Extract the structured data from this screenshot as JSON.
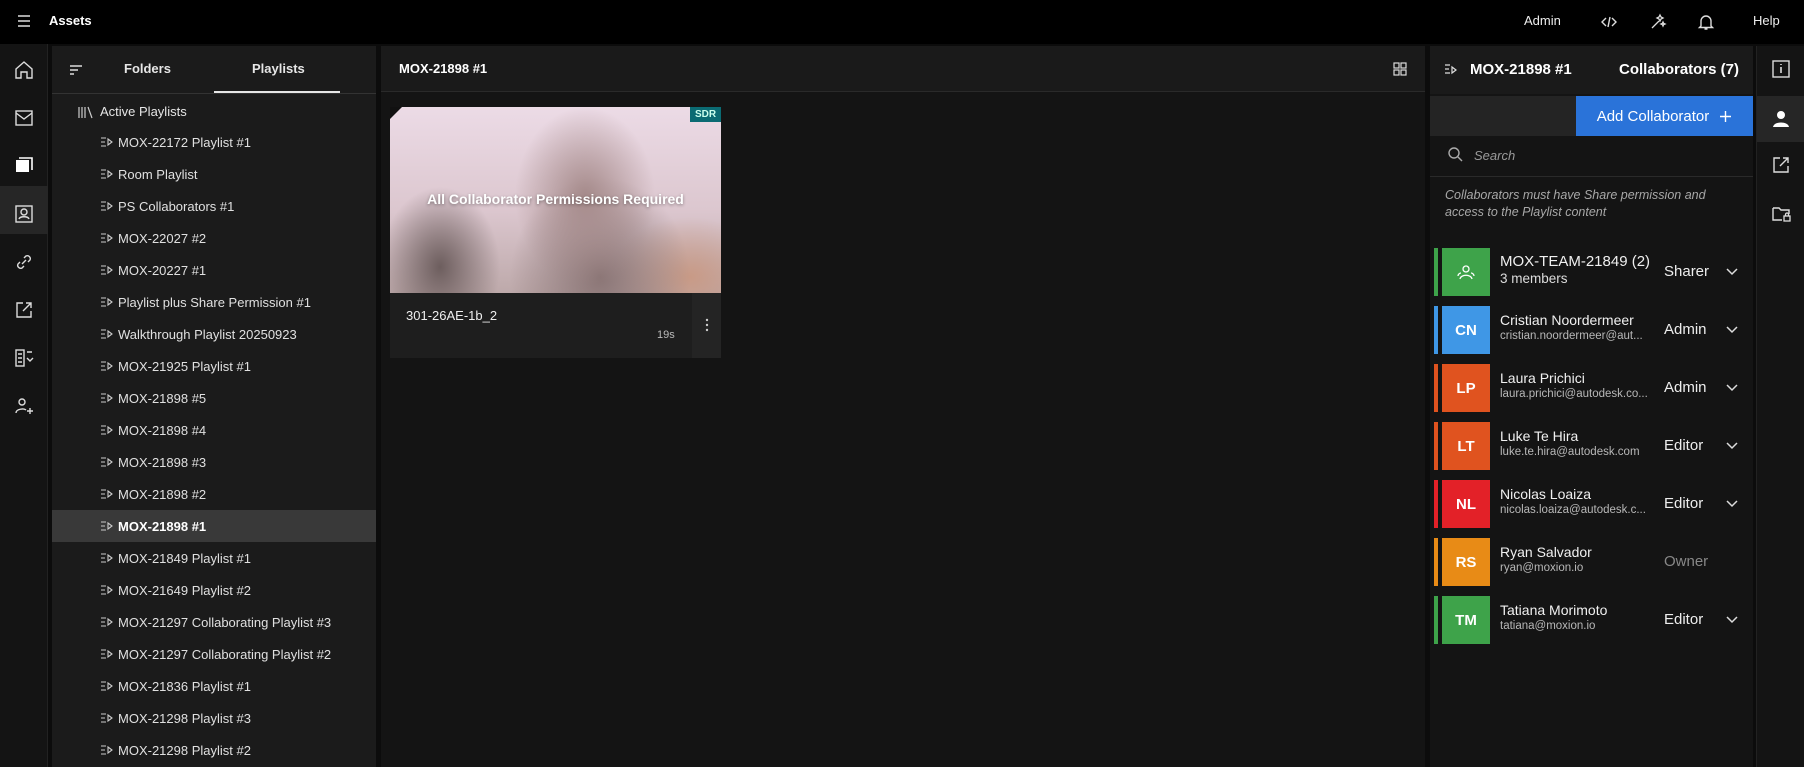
{
  "topbar": {
    "title": "Assets",
    "admin": "Admin",
    "help": "Help"
  },
  "sidebar": {
    "tabs": [
      {
        "label": "Folders"
      },
      {
        "label": "Playlists"
      }
    ],
    "section": "Active Playlists",
    "items": [
      "MOX-22172 Playlist #1",
      "Room Playlist",
      "PS Collaborators #1",
      "MOX-22027 #2",
      "MOX-20227 #1",
      "Playlist plus Share Permission #1",
      "Walkthrough Playlist 20250923",
      "MOX-21925 Playlist #1",
      "MOX-21898 #5",
      "MOX-21898 #4",
      "MOX-21898 #3",
      "MOX-21898 #2",
      "MOX-21898 #1",
      "MOX-21849 Playlist #1",
      "MOX-21649 Playlist #2",
      "MOX-21297 Collaborating Playlist #3",
      "MOX-21297 Collaborating Playlist #2",
      "MOX-21836 Playlist #1",
      "MOX-21298 Playlist #3",
      "MOX-21298 Playlist #2"
    ],
    "selected_index": 12
  },
  "center": {
    "title": "MOX-21898 #1",
    "card": {
      "message": "All Collaborator Permissions Required",
      "badge": "SDR",
      "name": "301-26AE-1b_2",
      "duration": "19s"
    }
  },
  "panel": {
    "title": "MOX-21898 #1",
    "count_label": "Collaborators (7)",
    "add_label": "Add Collaborator",
    "search_placeholder": "Search",
    "note": "Collaborators must have Share permission and access to the Playlist content",
    "collaborators": [
      {
        "name": "MOX-TEAM-21849 (2)",
        "sub": "3 members",
        "role": "Sharer",
        "initials": "",
        "color": "#3ea34a",
        "team": true,
        "chevron": true
      },
      {
        "name": "Cristian Noordermeer",
        "sub": "cristian.noordermeer@aut...",
        "role": "Admin",
        "initials": "CN",
        "color": "#3f97e6",
        "team": false,
        "chevron": true
      },
      {
        "name": "Laura Prichici",
        "sub": "laura.prichici@autodesk.co...",
        "role": "Admin",
        "initials": "LP",
        "color": "#e0531f",
        "team": false,
        "chevron": true
      },
      {
        "name": "Luke Te Hira",
        "sub": "luke.te.hira@autodesk.com",
        "role": "Editor",
        "initials": "LT",
        "color": "#e0531f",
        "team": false,
        "chevron": true
      },
      {
        "name": "Nicolas Loaiza",
        "sub": "nicolas.loaiza@autodesk.c...",
        "role": "Editor",
        "initials": "NL",
        "color": "#e32128",
        "team": false,
        "chevron": true
      },
      {
        "name": "Ryan Salvador",
        "sub": "ryan@moxion.io",
        "role": "Owner",
        "initials": "RS",
        "color": "#e88b16",
        "team": false,
        "chevron": false
      },
      {
        "name": "Tatiana Morimoto",
        "sub": "tatiana@moxion.io",
        "role": "Editor",
        "initials": "TM",
        "color": "#3ea34a",
        "team": false,
        "chevron": true
      }
    ]
  },
  "icons": {
    "topbar": [
      "menu-icon",
      "code-icon",
      "sparkle-icon",
      "bell-icon"
    ],
    "rail": [
      "home-icon",
      "inbox-icon",
      "playlists-icon",
      "contacts-icon",
      "link-icon",
      "share-icon",
      "review-icon",
      "user-settings-icon"
    ],
    "right_rail": [
      "info-icon",
      "person-icon",
      "external-share-icon",
      "folder-lock-icon"
    ]
  }
}
